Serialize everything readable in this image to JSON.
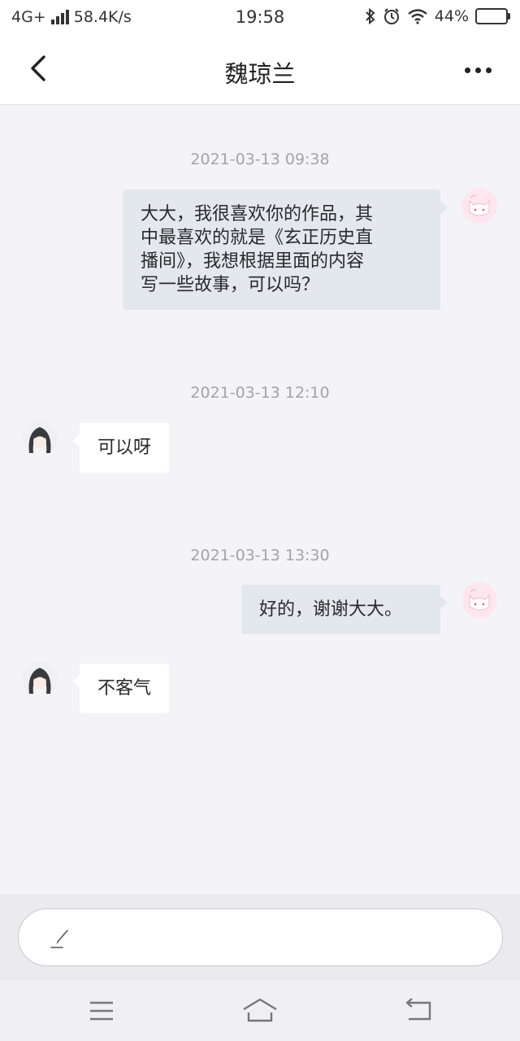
{
  "status_bar": {
    "network": "4G+",
    "speed": "58.4K/s",
    "time": "19:58",
    "battery": "44%",
    "battery_level": 0.44
  },
  "header": {
    "title": "魏琼兰"
  },
  "messages": [
    {
      "timestamp": "2021-03-13 09:38",
      "sender": "me",
      "lines": [
        "大大，我很喜欢你的作品，其",
        "中最喜欢的就是《玄正历史直",
        "播间》，我想根据里面的内容",
        "写一些故事，可以吗？"
      ]
    },
    {
      "timestamp": "2021-03-13 12:10",
      "sender": "them",
      "text": "可以呀"
    },
    {
      "timestamp": "2021-03-13 13:30",
      "sender": "me",
      "text": "好的，谢谢大大。"
    },
    {
      "sender": "them",
      "text": "不客气"
    }
  ],
  "input": {
    "placeholder": ""
  },
  "colors": {
    "my_bubble": "#e3e7ee",
    "their_bubble": "#ffffff",
    "background": "#f4f4f8"
  }
}
